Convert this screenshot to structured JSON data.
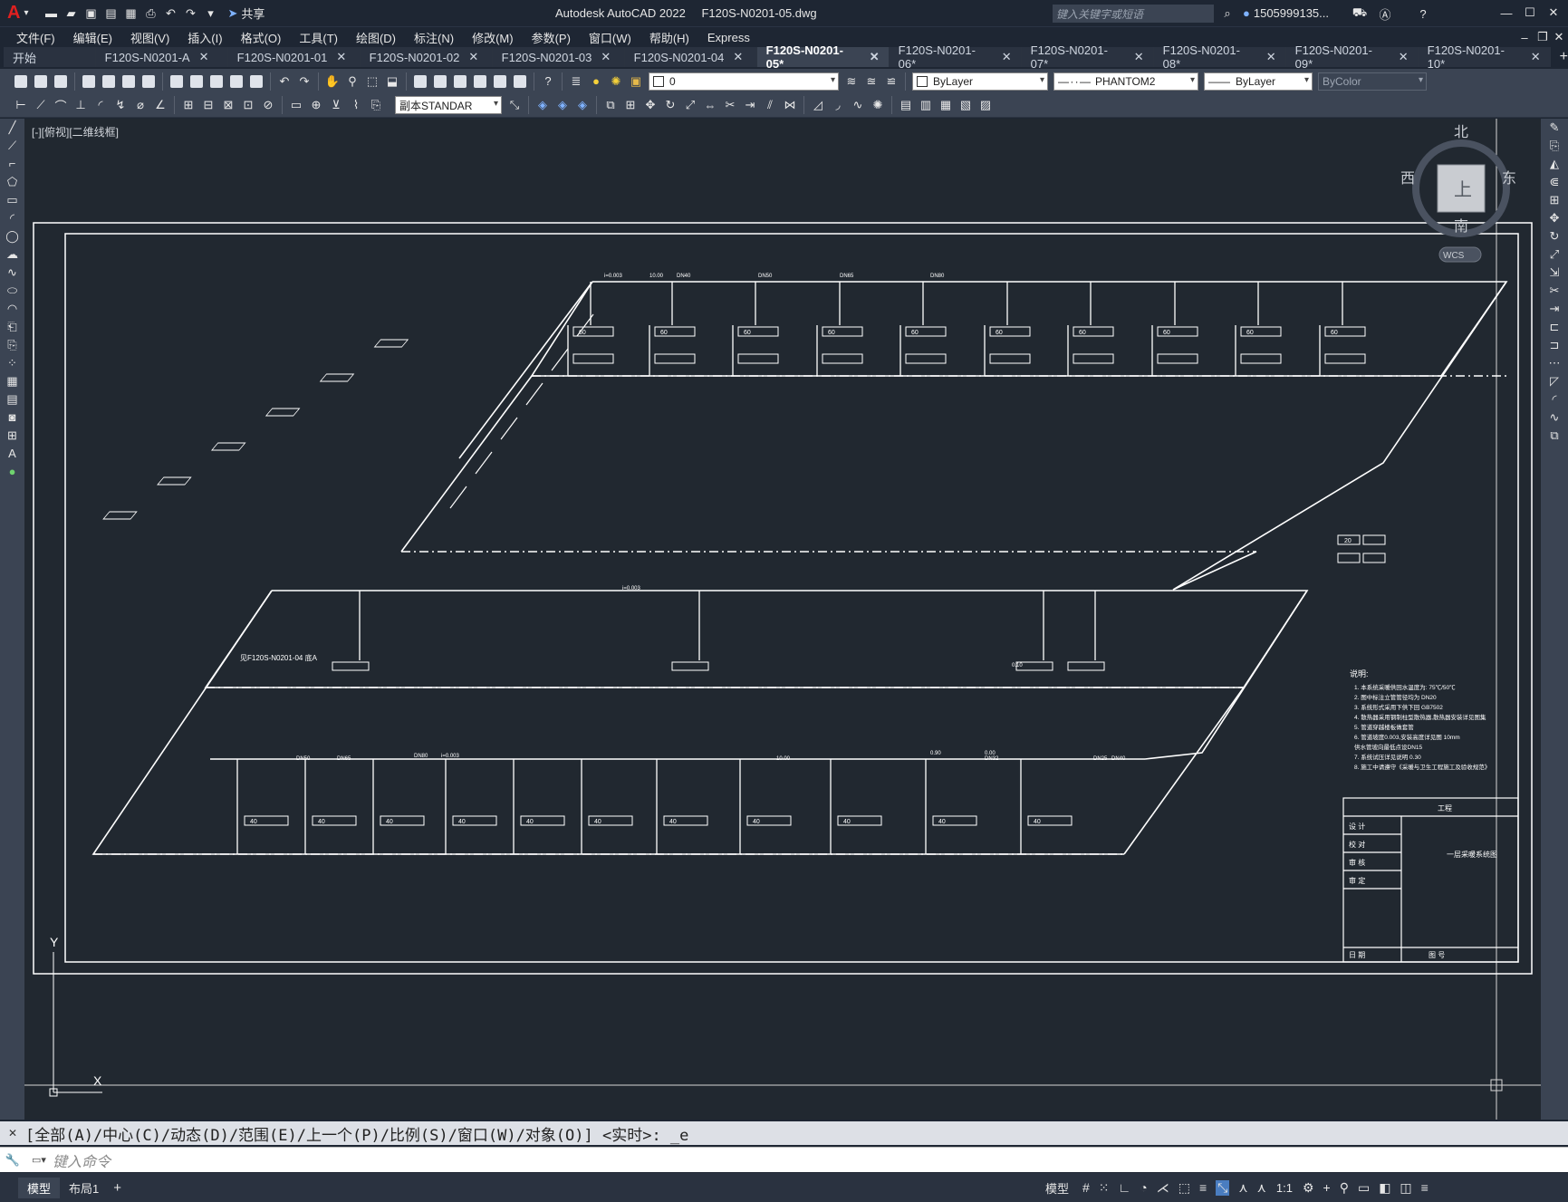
{
  "titlebar": {
    "app_title": "Autodesk AutoCAD 2022",
    "file_name": "F120S-N0201-05.dwg",
    "share_label": "共享",
    "search_placeholder": "键入关键字或短语",
    "user": "1505999135..."
  },
  "menu": [
    "文件(F)",
    "编辑(E)",
    "视图(V)",
    "插入(I)",
    "格式(O)",
    "工具(T)",
    "绘图(D)",
    "标注(N)",
    "修改(M)",
    "参数(P)",
    "窗口(W)",
    "帮助(H)",
    "Express"
  ],
  "tabs": {
    "start": "开始",
    "files": [
      "F120S-N0201-A",
      "F120S-N0201-01",
      "F120S-N0201-02",
      "F120S-N0201-03",
      "F120S-N0201-04",
      "F120S-N0201-05*",
      "F120S-N0201-06*",
      "F120S-N0201-07*",
      "F120S-N0201-08*",
      "F120S-N0201-09*",
      "F120S-N0201-10*"
    ],
    "active_index": 5
  },
  "toolbar": {
    "layer_value": "0",
    "color_value": "ByLayer",
    "linetype_value": "PHANTOM2",
    "lineweight_value": "ByLayer",
    "plotstyle_value": "ByColor",
    "textstyle_value": "副本STANDAR"
  },
  "viewport": {
    "label": "[-][俯视][二维线框]",
    "compass": {
      "north": "北",
      "south": "南",
      "east": "东",
      "west": "西",
      "top": "上"
    },
    "wcs": "WCS",
    "ucs_y": "Y",
    "ucs_x": "X"
  },
  "drawing": {
    "elevations": [
      "i=0.003",
      "10.00",
      "DN40",
      "DN50",
      "DN65",
      "DN80",
      "i=0.003",
      "0.10",
      "DN32",
      "DN25",
      "DN40",
      "DN50",
      "DN65",
      "DN80",
      "i=0.003",
      "10.00",
      "0.90",
      "0.00"
    ],
    "radiator_label": "40",
    "radiator_label_alt": "60",
    "radiator_label_small": "20",
    "ref_note": "见F120S-N0201-04 底A",
    "notes_title": "说明:",
    "notes": [
      "1. 本系统采暖供回水温度为: 75℃/50℃",
      "2. 图中标注立管管径均为 DN20",
      "3. 系统形式采用下供下回 GB7502",
      "4. 散热器采用钢制柱型散热器,散热器安装详见图集",
      "5. 管道穿越楼板做套管",
      "6. 管道坡度0.003,安装高度详见图 10mm",
      "   供水管坡向最低点设DN15",
      "7. 系统试压详见说明 0.30",
      "8. 施工中请遵守《采暖与卫生工程施工及验收规范》"
    ],
    "titleblock": {
      "name": "工程",
      "drawing": "一层采暖系统图",
      "rows": [
        "设 计",
        "校 对",
        "审 核",
        "审 定",
        "日 期"
      ],
      "sheet": "图 号"
    }
  },
  "command": {
    "history": "[全部(A)/中心(C)/动态(D)/范围(E)/上一个(P)/比例(S)/窗口(W)/对象(O)] <实时>: _e",
    "placeholder": "键入命令"
  },
  "status": {
    "model_tab": "模型",
    "layout_tab": "布局1",
    "model_label": "模型",
    "scale": "1:1"
  }
}
